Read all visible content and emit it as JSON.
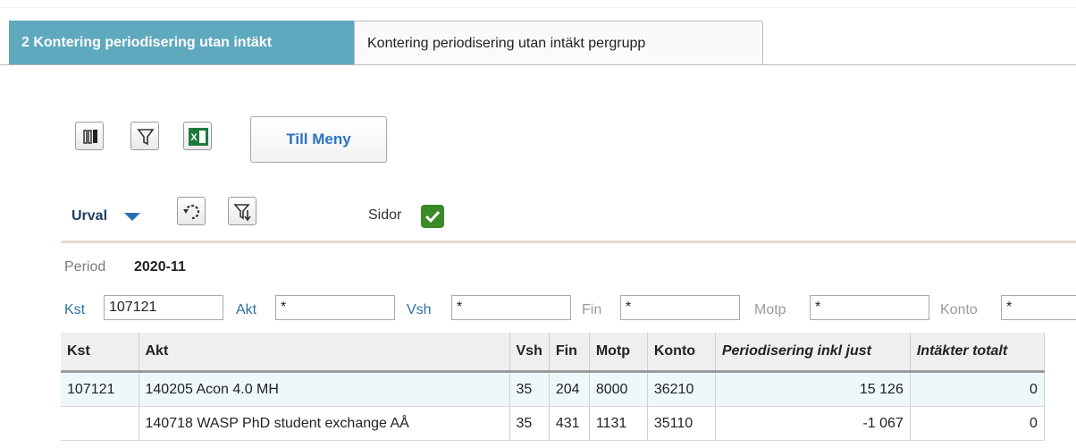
{
  "tabs": [
    {
      "label": "2 Kontering periodisering utan intäkt",
      "active": true
    },
    {
      "label": "Kontering periodisering utan intäkt pergrupp",
      "active": false
    }
  ],
  "toolbar": {
    "columns_icon": "columns-icon",
    "filter_icon": "filter-icon",
    "excel_icon": "excel-icon",
    "menu_button": "Till Meny"
  },
  "selection": {
    "urval_label": "Urval",
    "refresh_icon": "refresh-icon",
    "apply_filter_icon": "filter-apply-icon",
    "sidor_label": "Sidor",
    "sidor_checked": true
  },
  "period": {
    "label": "Period",
    "value": "2020-11"
  },
  "filters": {
    "kst": {
      "label": "Kst",
      "value": "107121"
    },
    "akt": {
      "label": "Akt",
      "value": "*"
    },
    "vsh": {
      "label": "Vsh",
      "value": "*"
    },
    "fin": {
      "label": "Fin",
      "value": "*"
    },
    "motp": {
      "label": "Motp",
      "value": "*"
    },
    "konto": {
      "label": "Konto",
      "value": "*"
    }
  },
  "table": {
    "headers": [
      "Kst",
      "Akt",
      "Vsh",
      "Fin",
      "Motp",
      "Konto",
      "Periodisering inkl just",
      "Intäkter totalt"
    ],
    "rows": [
      [
        "107121",
        "140205 Acon 4.0 MH",
        "35",
        "204",
        "8000",
        "36210",
        "15 126",
        "0"
      ],
      [
        "",
        "140718 WASP PhD student exchange AÅ",
        "35",
        "431",
        "1131",
        "35110",
        "-1 067",
        "0"
      ]
    ]
  },
  "colors": {
    "active_tab": "#5fa9bf",
    "link_blue": "#2e6fa8",
    "button_text": "#2a73c4",
    "check_green": "#3a8a25",
    "row_highlight": "#eef8fb"
  }
}
